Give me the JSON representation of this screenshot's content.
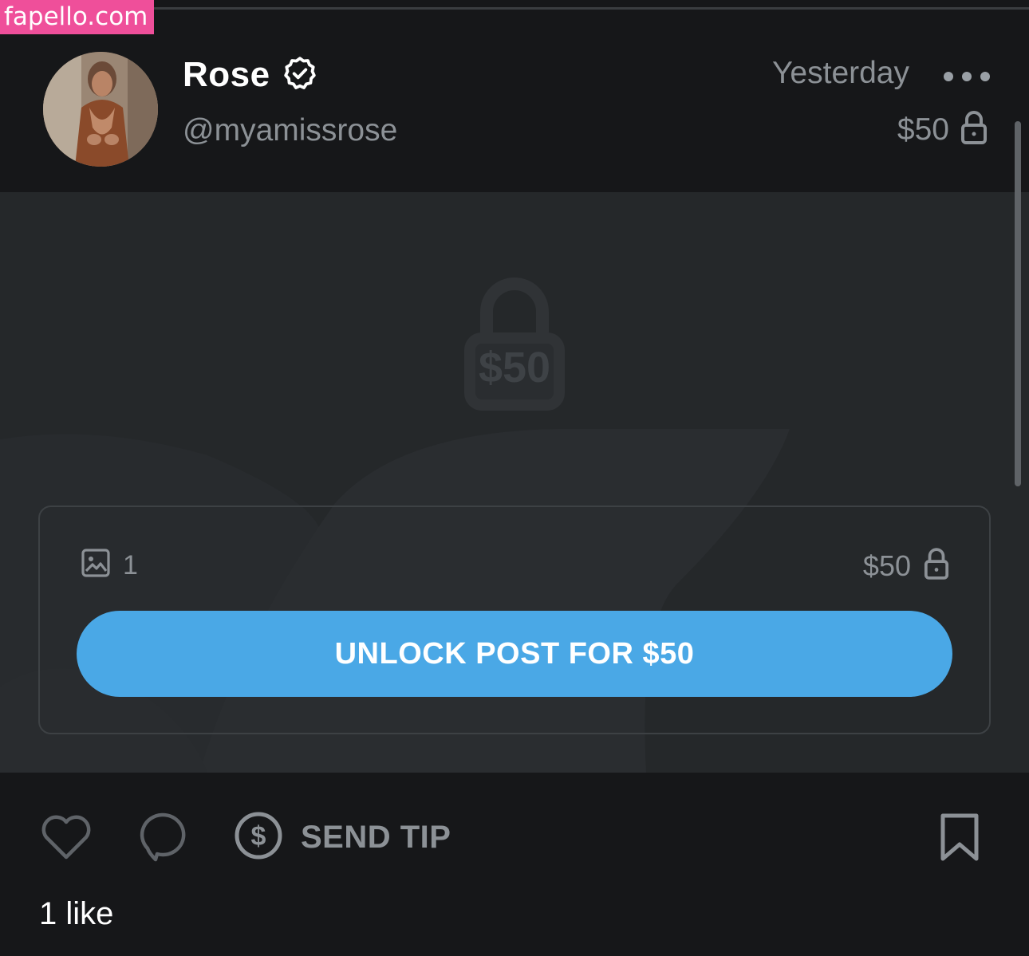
{
  "watermark": {
    "text": "fapello.com",
    "color": "#ef4f9a"
  },
  "post": {
    "author": {
      "name": "Rose",
      "handle": "@myamissrose",
      "verified": true,
      "verified_icon": "verified-badge-icon"
    },
    "timestamp": "Yesterday",
    "menu_icon": "more-horizontal-icon",
    "price": "$50",
    "price_icon": "lock-icon",
    "locked_media": {
      "overlay_price": "$50",
      "media_count": "1",
      "media_icon": "image-icon",
      "price": "$50",
      "unlock_label": "UNLOCK POST FOR $50",
      "accent_color": "#4aa8e6"
    },
    "actions": {
      "like_icon": "heart-icon",
      "comment_icon": "comment-icon",
      "tip_icon": "dollar-circle-icon",
      "tip_label": "SEND TIP",
      "bookmark_icon": "bookmark-icon"
    },
    "likes_text": "1 like"
  }
}
